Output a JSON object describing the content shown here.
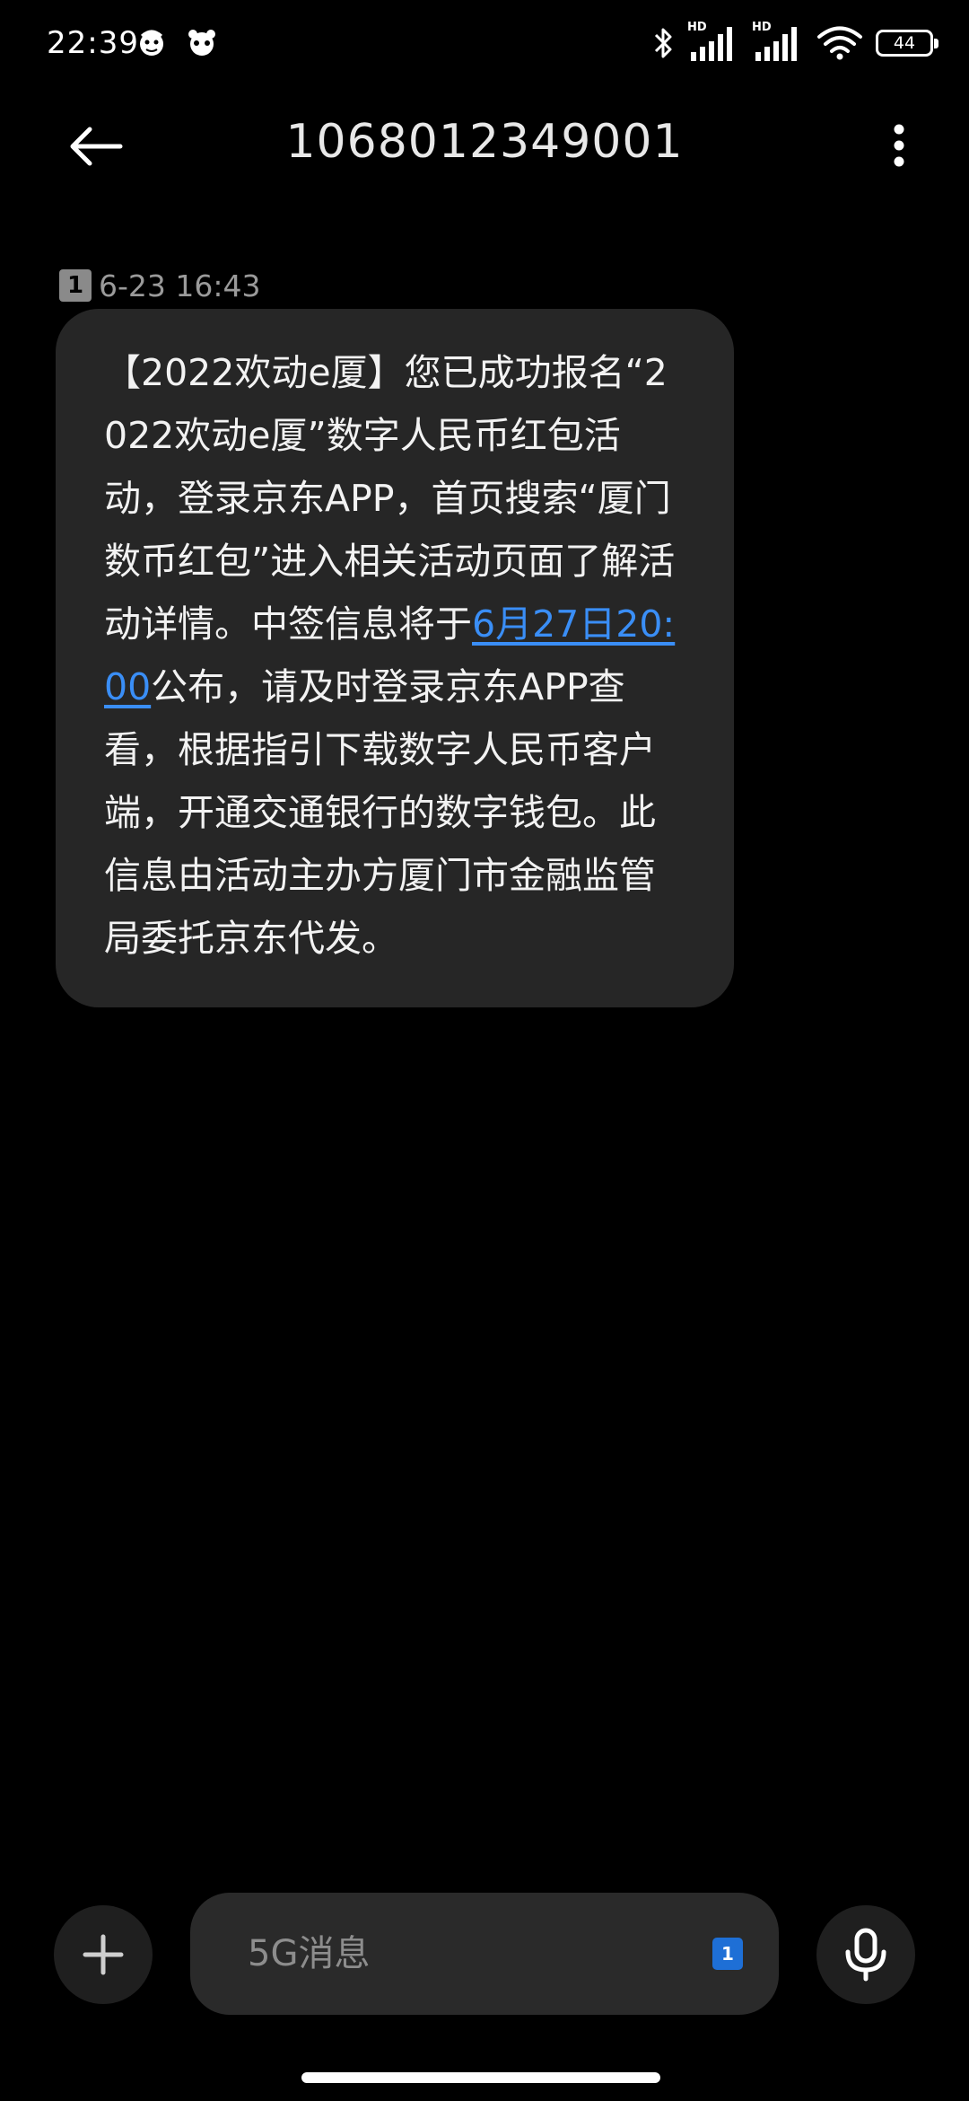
{
  "status_bar": {
    "time": "22:39",
    "hd_label_1": "HD",
    "hd_label_2": "HD",
    "battery_level": "44",
    "icons": [
      "cartoon-notification-icon",
      "cartoon-notification-icon",
      "bluetooth-icon",
      "signal-icon",
      "signal-icon",
      "wifi-icon",
      "battery-icon"
    ]
  },
  "header": {
    "title": "1068012349001"
  },
  "message": {
    "sim_slot": "1",
    "timestamp": "6-23 16:43",
    "text_before_link": "【2022欢动e厦】您已成功报名“2022欢动e厦”数字人民币红包活动，登录京东APP，首页搜索“厦门数币红包”进入相关活动页面了解活动详情。中签信息将于",
    "link_text": "6月27日20:00",
    "text_after_link": "公布，请及时登录京东APP查看，根据指引下载数字人民币客户端，开通交通银行的数字钱包。此信息由活动主办方厦门市金融监管局委托京东代发。"
  },
  "composer": {
    "placeholder": "5G消息",
    "sim_slot": "1"
  },
  "colors": {
    "background": "#000000",
    "bubble": "#262626",
    "link": "#3a8ef6",
    "sim_badge": "#1e6fd6"
  }
}
